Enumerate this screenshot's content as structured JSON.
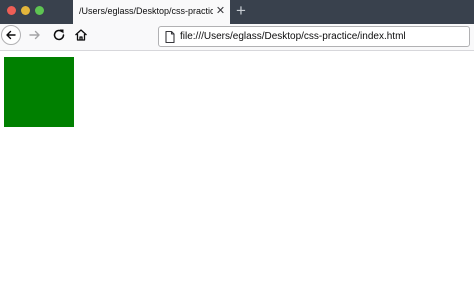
{
  "window": {
    "traffic_colors": {
      "close": "#ee5e56",
      "minimize": "#e3b53b",
      "maximize": "#5ec452"
    }
  },
  "tabs": [
    {
      "label": "/Users/eglass/Desktop/css-practice/index.html",
      "active": true,
      "close_icon": "close-icon"
    }
  ],
  "new_tab_icon": "plus-icon",
  "toolbar": {
    "back_icon": "back-arrow-icon",
    "forward_icon": "forward-arrow-icon",
    "reload_icon": "reload-icon",
    "home_icon": "home-icon"
  },
  "urlbar": {
    "site_icon": "document-icon",
    "url": "file:///Users/eglass/Desktop/css-practice/index.html"
  },
  "page": {
    "background": "#ffffff",
    "box_color": "#008000"
  }
}
